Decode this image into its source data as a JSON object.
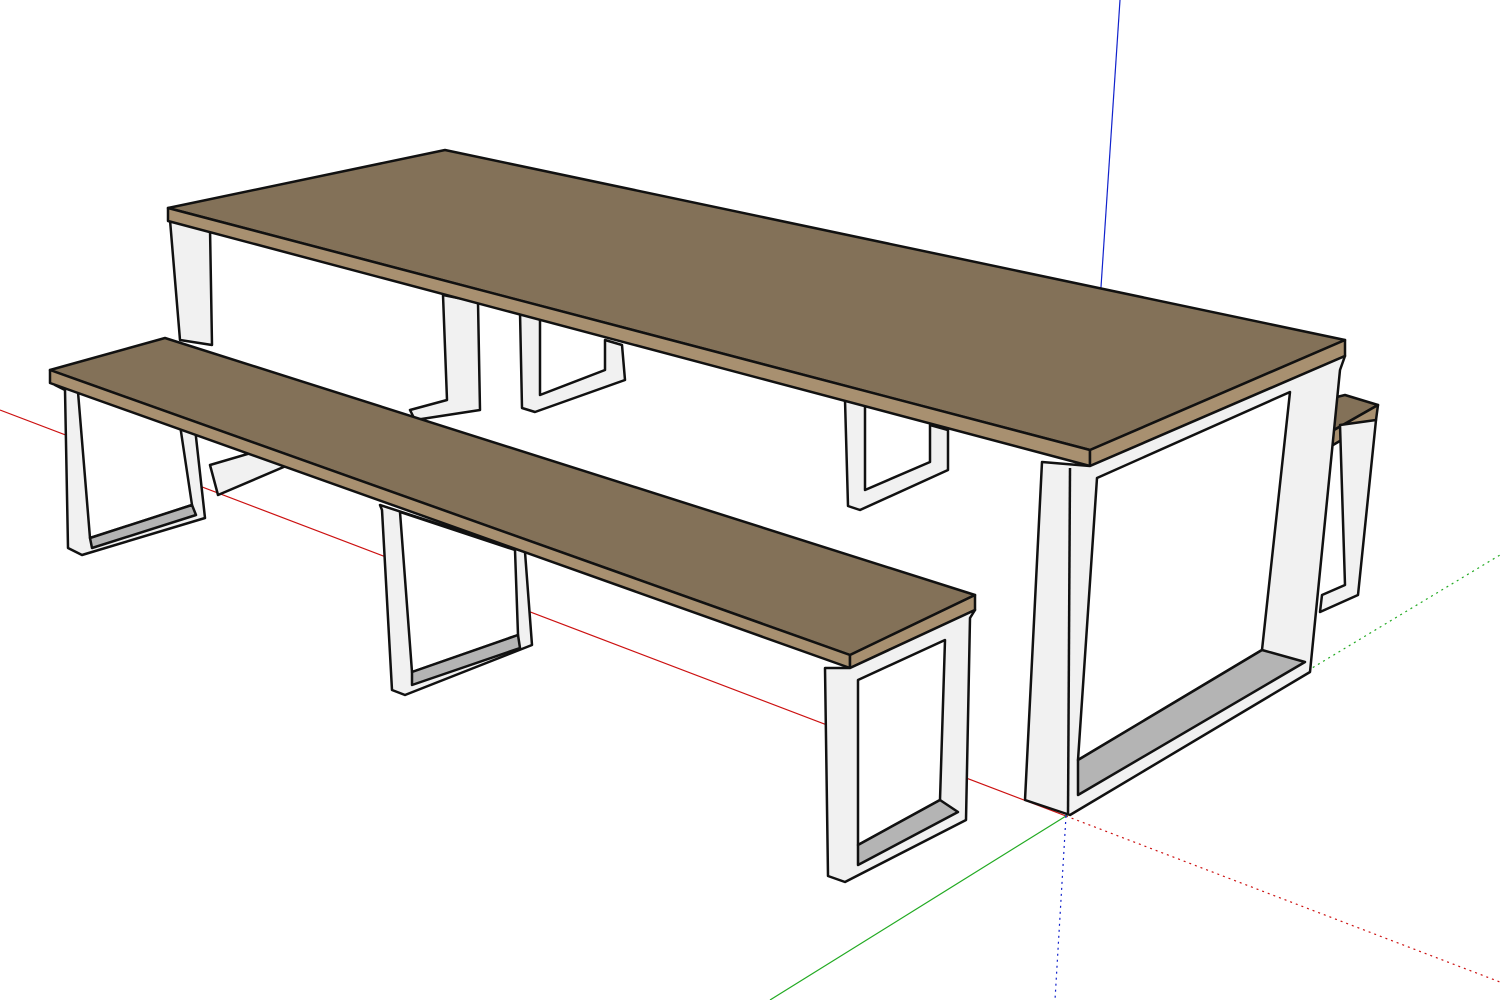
{
  "viewport": {
    "background": "#ffffff"
  },
  "colors": {
    "wood_top": "#837158",
    "wood_edge": "#a89070",
    "frame_white": "#f1f1f1",
    "frame_shadow": "#b4b4b4",
    "edge": "#111111",
    "axis_red": "#cc1111",
    "axis_green": "#22aa22",
    "axis_blue": "#1122cc"
  },
  "model": {
    "objects": [
      "table",
      "bench-front",
      "bench-back"
    ]
  }
}
